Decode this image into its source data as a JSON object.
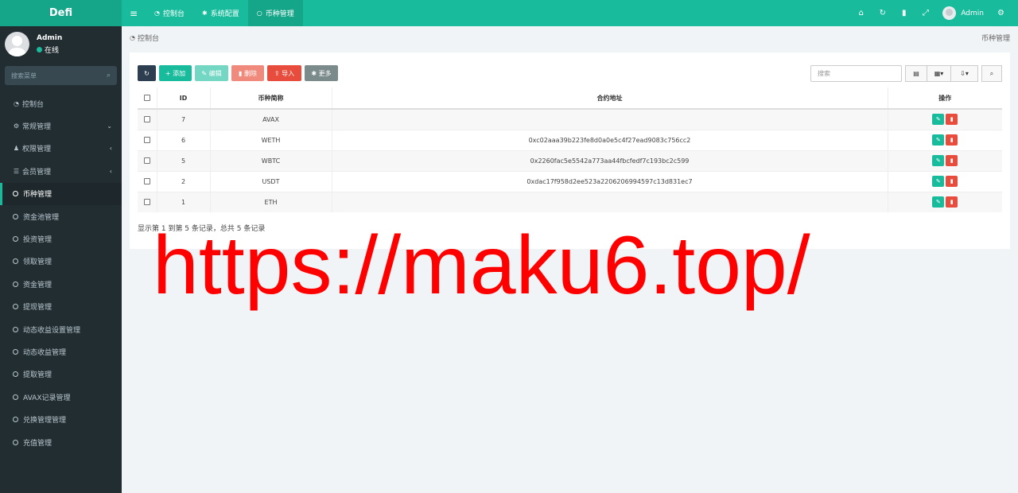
{
  "topbar": {
    "logo": "Defi",
    "tabs": [
      {
        "label": "控制台",
        "active": false
      },
      {
        "label": "系统配置",
        "active": false
      },
      {
        "label": "币种管理",
        "active": true
      }
    ],
    "username": "Admin"
  },
  "sidebar": {
    "user": {
      "name": "Admin",
      "status": "在线"
    },
    "search_placeholder": "搜索菜单",
    "items": [
      {
        "label": "控制台",
        "icon": "dashboard-icon"
      },
      {
        "label": "常规管理",
        "icon": "cogs-icon",
        "arrow": "⌄"
      },
      {
        "label": "权限管理",
        "icon": "group-icon",
        "arrow": "‹"
      },
      {
        "label": "会员管理",
        "icon": "list-icon",
        "arrow": "‹"
      },
      {
        "label": "币种管理",
        "icon": "circle-icon",
        "active": true
      },
      {
        "label": "资金池管理",
        "icon": "circle-icon"
      },
      {
        "label": "投资管理",
        "icon": "circle-icon"
      },
      {
        "label": "领取管理",
        "icon": "circle-icon"
      },
      {
        "label": "资金管理",
        "icon": "circle-icon"
      },
      {
        "label": "提现管理",
        "icon": "circle-icon"
      },
      {
        "label": "动态收益设置管理",
        "icon": "circle-icon"
      },
      {
        "label": "动态收益管理",
        "icon": "circle-icon"
      },
      {
        "label": "提取管理",
        "icon": "circle-icon"
      },
      {
        "label": "AVAX记录管理",
        "icon": "circle-icon"
      },
      {
        "label": "兑换管理管理",
        "icon": "circle-icon"
      },
      {
        "label": "充值管理",
        "icon": "circle-icon"
      }
    ]
  },
  "breadcrumb": {
    "left": "控制台",
    "right": "币种管理"
  },
  "toolbar": {
    "add": "添加",
    "edit": "编辑",
    "delete": "删除",
    "import": "导入",
    "more": "更多",
    "search_placeholder": "搜索"
  },
  "table": {
    "headers": [
      "ID",
      "币种简称",
      "合约地址",
      "操作"
    ],
    "rows": [
      {
        "id": "7",
        "symbol": "AVAX",
        "address": ""
      },
      {
        "id": "6",
        "symbol": "WETH",
        "address": "0xc02aaa39b223fe8d0a0e5c4f27ead9083c756cc2"
      },
      {
        "id": "5",
        "symbol": "WBTC",
        "address": "0x2260fac5e5542a773aa44fbcfedf7c193bc2c599"
      },
      {
        "id": "2",
        "symbol": "USDT",
        "address": "0xdac17f958d2ee523a2206206994597c13d831ec7"
      },
      {
        "id": "1",
        "symbol": "ETH",
        "address": ""
      }
    ]
  },
  "pagination": {
    "info": "显示第 1 到第 5 条记录，总共 5 条记录"
  },
  "watermark": "https://maku6.top/",
  "colors": {
    "accent": "#18bc9c",
    "sidebar": "#222d32",
    "danger": "#e74c3c",
    "watermark": "#ff0000"
  }
}
